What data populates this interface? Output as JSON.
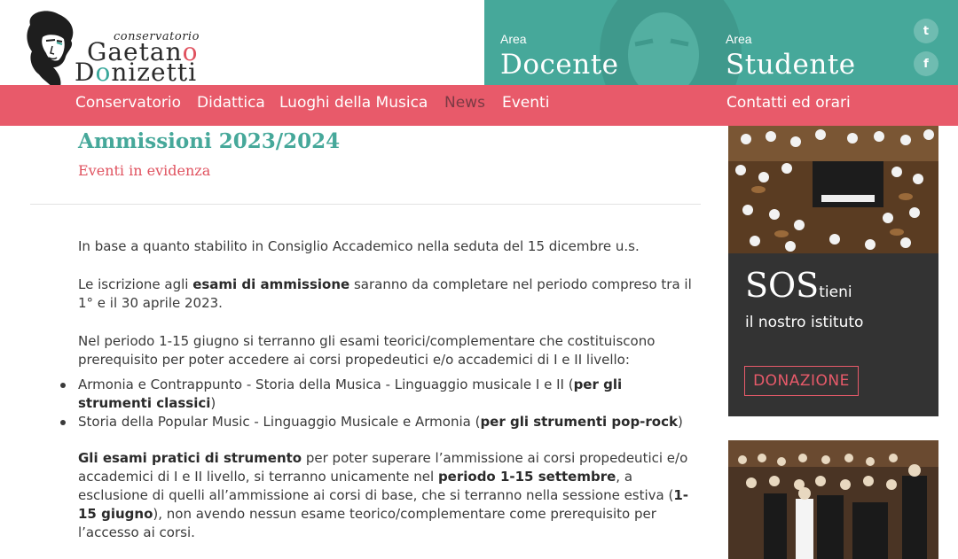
{
  "logo": {
    "small": "conservatorio",
    "line1_a": "Gaetan",
    "line1_b": "o",
    "line2_a": "D",
    "line2_b": "o",
    "line2_c": "nizetti"
  },
  "header": {
    "docente_small": "Area",
    "docente_big": "Docente",
    "studente_small": "Area",
    "studente_big": "Studente",
    "twitter_glyph": "t",
    "facebook_glyph": "f",
    "twitter_icon": "twitter-icon",
    "facebook_icon": "facebook-icon"
  },
  "nav": {
    "items": [
      "Conservatorio",
      "Didattica",
      "Luoghi della Musica",
      "News",
      "Eventi"
    ],
    "active": "News",
    "contatti": "Contatti ed orari"
  },
  "article": {
    "title": "Ammissioni 2023/2024",
    "subtitle": "Eventi in evidenza",
    "p1": "In base a quanto stabilito in Consiglio Accademico nella seduta del 15 dicembre u.s.",
    "p2_a": "Le iscrizione agli ",
    "p2_b": "esami di ammissione",
    "p2_c": " saranno da completare nel periodo compreso tra il 1° e il 30 aprile 2023.",
    "p3": "Nel periodo 1-15 giugno si terranno gli esami teorici/complementare che costituiscono prerequisito per poter accedere ai corsi propedeutici e/o accademici di I e II livello:",
    "li1_a": "Armonia e Contrappunto - Storia della Musica - Linguaggio musicale I e II (",
    "li1_b": "per gli strumenti classici",
    "li1_c": ")",
    "li2_a": "Storia della Popular Music - Linguaggio Musicale e Armonia (",
    "li2_b": "per gli strumenti pop-rock",
    "li2_c": ")",
    "p4_a": "Gli esami pratici di strumento",
    "p4_b": " per poter superare l’ammissione ai corsi propedeutici e/o accademici di I e II livello, si terranno unicamente nel ",
    "p4_c": "periodo 1-15 settembre",
    "p4_d": ", a esclusione di quelli all’ammissione ai corsi di base, che si terranno nella sessione estiva (",
    "p4_e": "1-15 giugno",
    "p4_f": "), non avendo nessun esame teorico/complementare come prerequisito per l’accesso ai corsi."
  },
  "sidebar": {
    "sos_big": "SOS",
    "sos_small": "tieni",
    "sos_line": "il nostro istituto",
    "donate": "DONAZIONE"
  },
  "colors": {
    "teal": "#46a89a",
    "coral": "#e85a6a",
    "dark_box": "#333333"
  }
}
